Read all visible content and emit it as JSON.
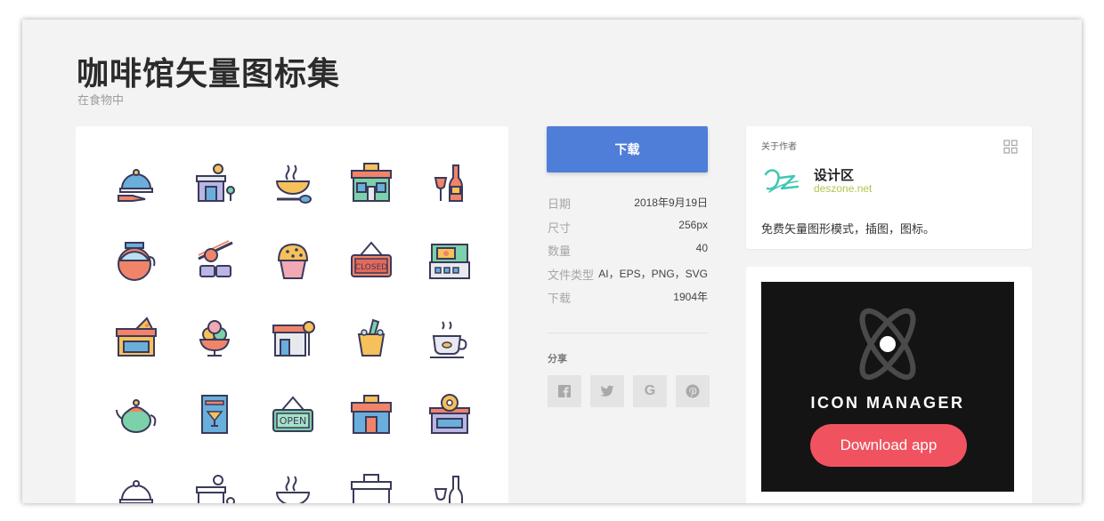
{
  "page": {
    "title": "咖啡馆矢量图标集",
    "subtitle": "在食物中"
  },
  "preview": {
    "icons": [
      "cloche-serving-icon",
      "ice-cream-shop-icon",
      "noodle-bowl-icon",
      "bakery-storefront-icon",
      "wine-bottle-glass-icon",
      "coffee-carafe-icon",
      "sushi-chopsticks-icon",
      "muffin-icon",
      "closed-sign-icon",
      "cash-register-icon",
      "pizza-shop-icon",
      "ice-cream-cup-icon",
      "candy-shop-icon",
      "wine-bucket-icon",
      "coffee-cup-icon",
      "teapot-icon",
      "menu-book-icon",
      "open-sign-icon",
      "cafe-storefront-icon",
      "donut-shop-icon",
      "cloche-outline-icon",
      "ice-cream-shop-outline-icon",
      "noodle-bowl-outline-icon",
      "storefront-outline-icon",
      "wine-bottle-outline-icon"
    ],
    "closed_text": "CLOSED",
    "open_text": "OPEN"
  },
  "download": {
    "label": "下载"
  },
  "meta": [
    {
      "label": "日期",
      "value": "2018年9月19日"
    },
    {
      "label": "尺寸",
      "value": "256px"
    },
    {
      "label": "数量",
      "value": "40"
    },
    {
      "label": "文件类型",
      "value": "AI，EPS，PNG，SVG"
    },
    {
      "label": "下载",
      "value": "1904年"
    }
  ],
  "share": {
    "label": "分享",
    "buttons": [
      {
        "name": "facebook",
        "glyph": "f"
      },
      {
        "name": "twitter",
        "glyph": "t"
      },
      {
        "name": "google",
        "glyph": "G"
      },
      {
        "name": "pinterest",
        "glyph": "P"
      }
    ]
  },
  "author": {
    "heading": "关于作者",
    "name": "设计区",
    "url": "deszone.net",
    "description": "免费矢量图形模式，插图，图标。"
  },
  "ad": {
    "title": "ICON MANAGER",
    "button": "Download app"
  },
  "colors": {
    "primary": "#4f7ed8",
    "ad_button": "#f0535f",
    "author_url": "#b2c54f",
    "background": "#f3f3f3"
  }
}
